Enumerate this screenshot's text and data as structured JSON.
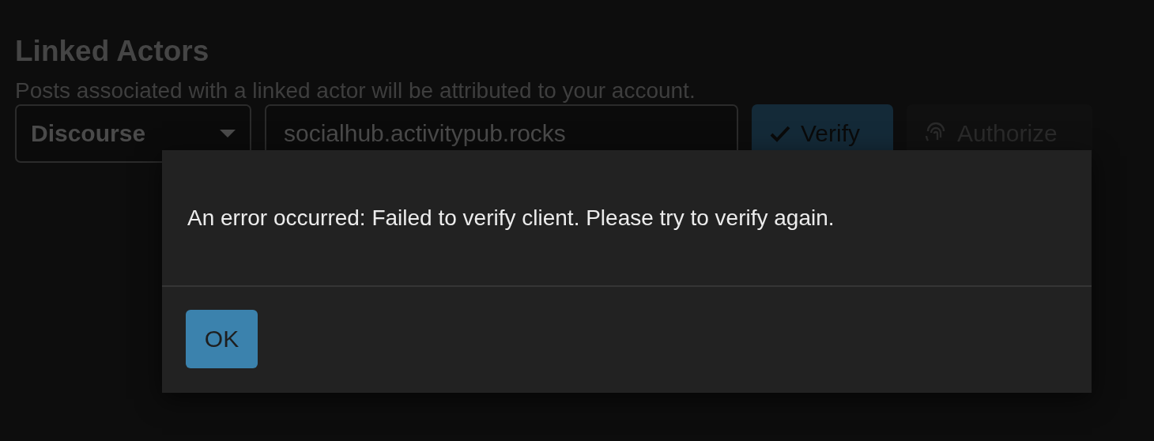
{
  "section": {
    "title": "Linked Actors",
    "description": "Posts associated with a linked actor will be attributed to your account.",
    "platform_select": {
      "value": "Discourse"
    },
    "server_field": {
      "value": "socialhub.activitypub.rocks"
    },
    "buttons": [
      {
        "label": "Verify",
        "kind": "primary"
      },
      {
        "label": "Authorize",
        "kind": "secondary"
      }
    ]
  },
  "dialog": {
    "message": "An error occurred: Failed to verify client. Please try to verify again.",
    "buttons": [
      "OK"
    ]
  }
}
